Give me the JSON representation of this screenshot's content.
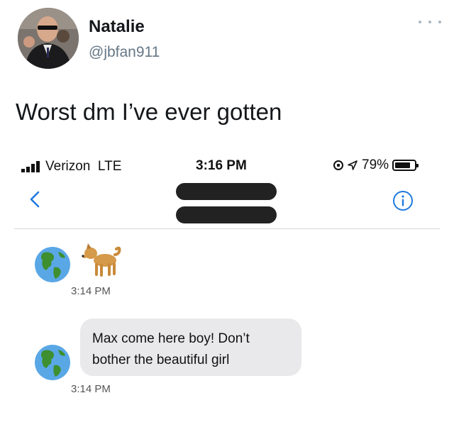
{
  "tweet": {
    "display_name": "Natalie",
    "handle": "@jbfan911",
    "text": "Worst dm I’ve ever gotten",
    "avatar_icon": "profile-photo"
  },
  "phone": {
    "status_bar": {
      "carrier": "Verizon  LTE",
      "time": "3:16 PM",
      "battery_text": "79%",
      "battery_level": 0.79
    },
    "nav": {
      "back_icon": "chevron-left-icon",
      "info_icon": "info-icon",
      "contact_name_redacted": true
    },
    "messages": [
      {
        "sender_avatar": "earth-globe-emoji",
        "content": "dog-emoji",
        "timestamp": "3:14 PM"
      },
      {
        "sender_avatar": "earth-globe-emoji",
        "line1": "Max come here boy! Don’t",
        "line2": "bother the beautiful girl",
        "timestamp": "3:14 PM"
      }
    ]
  },
  "colors": {
    "ios_blue": "#1f7ae0",
    "bubble_gray": "#e9e9eb",
    "handle_gray": "#657786"
  }
}
